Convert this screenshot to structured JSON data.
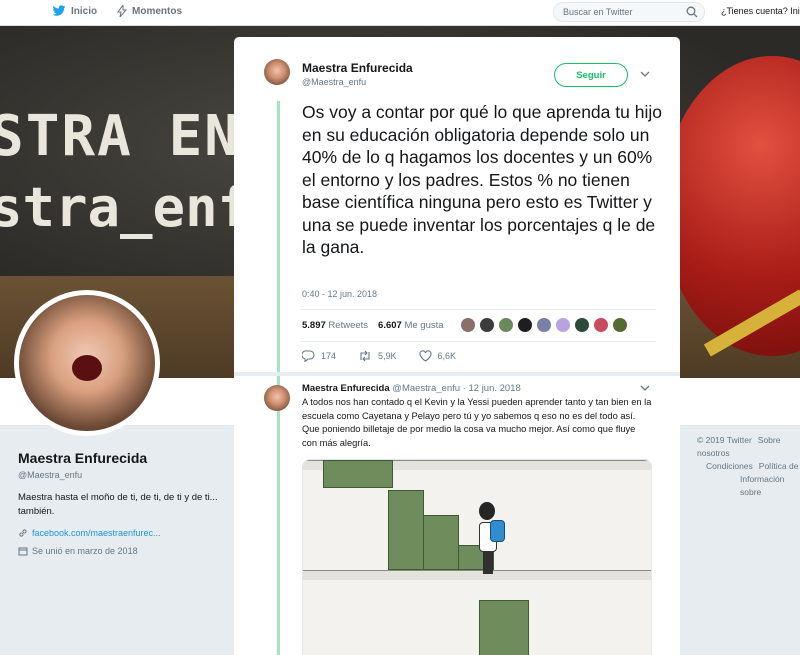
{
  "nav": {
    "home": "Inicio",
    "moments": "Momentos",
    "search_placeholder": "Buscar en Twitter",
    "account": "¿Tienes cuenta? Inicia"
  },
  "banner": {
    "line1": "STRA EN",
    "line2": "stra_enfu"
  },
  "profile": {
    "name": "Maestra Enfurecida",
    "handle": "@Maestra_enfu",
    "bio": "Maestra hasta el moño de ti, de ti, de ti y de ti... también.",
    "link": "facebook.com/maestraenfurec...",
    "joined": "Se unió en marzo de 2018"
  },
  "footer": {
    "line1a": "© 2019 Twitter",
    "line1b": "Sobre nosotros",
    "line2a": "Condiciones",
    "line2b": "Política de",
    "line3": "Información sobre"
  },
  "tweet": {
    "name": "Maestra Enfurecida",
    "handle": "@Maestra_enfu",
    "follow_label": "Seguir",
    "text": "Os voy a contar por qué lo que aprenda tu hijo en su educación obligatoria depende solo un 40% de lo q hagamos los docentes y un 60% el entorno y los padres. Estos % no tienen base científica ninguna pero esto es Twitter y una se puede inventar los porcentajes q le de la gana.",
    "time": "0:40 - 12 jun. 2018",
    "retweets_count": "5.897",
    "retweets_label": "Retweets",
    "likes_count": "6.607",
    "likes_label": "Me gusta",
    "replies": "174",
    "retweets_short": "5,9K",
    "likes_short": "6,6K",
    "liker_colors": [
      "#8a6f6a",
      "#3b3b3b",
      "#6a8a5e",
      "#1e1e1e",
      "#7a7fa8",
      "#b8a3e0",
      "#2c4a3a",
      "#c94b5e",
      "#556b2f"
    ]
  },
  "reply": {
    "name": "Maestra Enfurecida",
    "handle": "@Maestra_enfu",
    "date": "12 jun. 2018",
    "text": "A todos nos han contado q el Kevin y la Yessi pueden aprender tanto y tan bien en la escuela como Cayetana y Pelayo pero tú y yo sabemos q eso no es del todo así. Que poniendo billetaje de por medio la cosa va mucho mejor. Así como que fluye con más alegría."
  },
  "colors": {
    "accent": "#17bf63",
    "link": "#1b95e0",
    "thread": "#a0e5c4"
  }
}
